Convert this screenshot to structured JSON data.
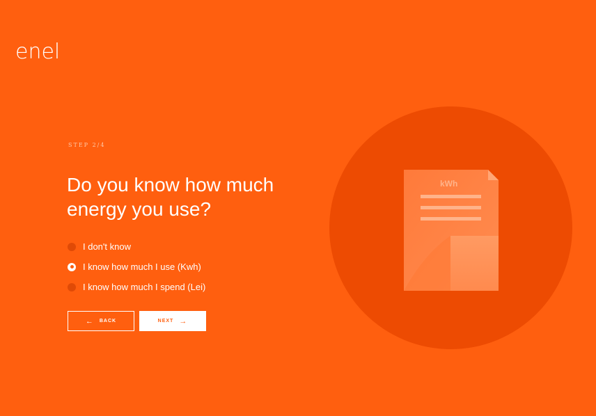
{
  "brand": {
    "logo_text": "enel"
  },
  "step": {
    "label": "STEP 2/4"
  },
  "question": {
    "title": "Do you know how much energy you use?"
  },
  "options": [
    {
      "label": "I don't know",
      "selected": false
    },
    {
      "label": "I know how much I use (Kwh)",
      "selected": true
    },
    {
      "label": "I know how much I spend (Lei)",
      "selected": false
    }
  ],
  "buttons": {
    "back_label": "BACK",
    "next_label": "NEXT",
    "back_icon": "arrow-left-icon",
    "next_icon": "arrow-right-icon"
  },
  "illustration": {
    "unit_label": "kWh",
    "icon": "bill-document-icon"
  },
  "colors": {
    "background": "#FF5F0F",
    "circle": "#ED4B02",
    "text": "#FFFFFF"
  }
}
